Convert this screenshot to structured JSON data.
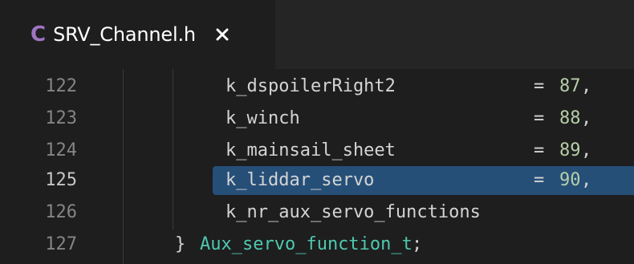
{
  "tab": {
    "icon": "C",
    "filename": "SRV_Channel.h",
    "close_icon": "close-icon"
  },
  "colors": {
    "editor_bg": "#1e1e1e",
    "tabbar_bg": "#252526",
    "selection": "#264f78",
    "c_icon": "#a074c4",
    "number": "#b5cea8",
    "type": "#4ec9b0",
    "line_number": "#858585",
    "line_number_active": "#c6c6c6"
  },
  "editor": {
    "active_line": 125,
    "lines": [
      {
        "number": "122",
        "ident": "k_dspoilerRight2",
        "eq": "=",
        "value": "87",
        "comma": ","
      },
      {
        "number": "123",
        "ident": "k_winch",
        "eq": "=",
        "value": "88",
        "comma": ","
      },
      {
        "number": "124",
        "ident": "k_mainsail_sheet",
        "eq": "=",
        "value": "89",
        "comma": ","
      },
      {
        "number": "125",
        "ident": "k_liddar_servo",
        "eq": "=",
        "value": "90",
        "comma": ","
      },
      {
        "number": "126",
        "ident": "k_nr_aux_servo_functions"
      },
      {
        "number": "127",
        "brace": "}",
        "type_name": "Aux_servo_function_t",
        "semicolon": ";"
      }
    ]
  }
}
